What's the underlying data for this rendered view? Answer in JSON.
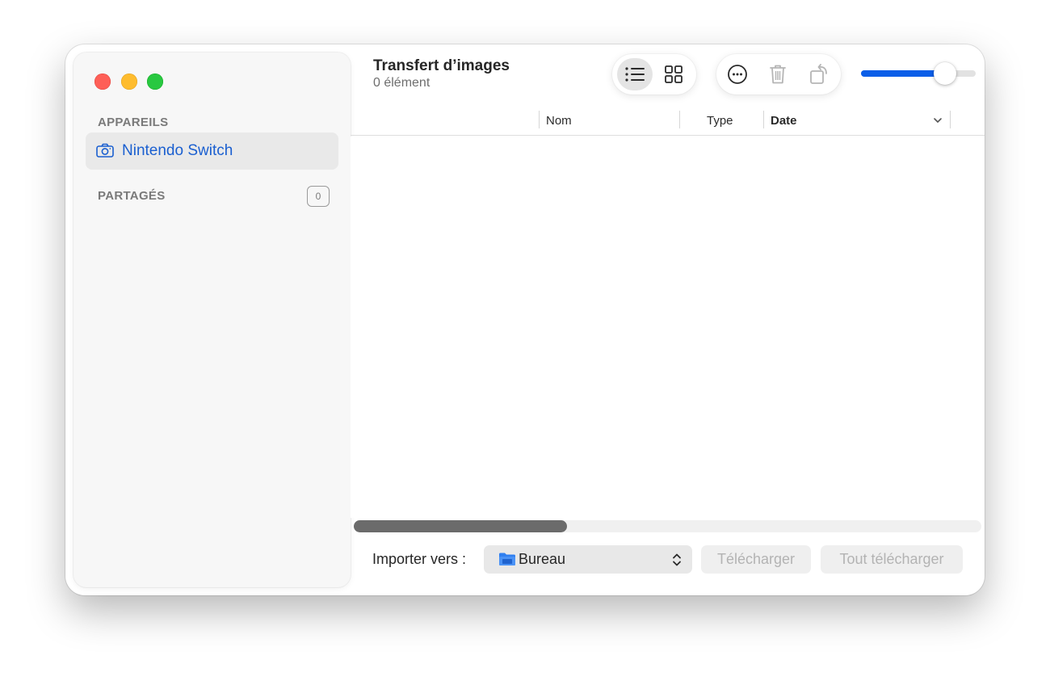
{
  "window": {
    "title": "Transfert d’images",
    "subtitle": "0 élément"
  },
  "sidebar": {
    "devices_header": "APPAREILS",
    "devices": [
      {
        "label": "Nintendo Switch",
        "icon": "camera-icon",
        "selected": true
      }
    ],
    "shared_header": "PARTAGÉS",
    "shared_count": "0"
  },
  "toolbar": {
    "view_modes": [
      {
        "name": "list-view",
        "icon": "list-icon",
        "active": true
      },
      {
        "name": "grid-view",
        "icon": "grid-icon",
        "active": false
      }
    ],
    "actions": [
      {
        "name": "more",
        "icon": "ellipsis-circle-icon",
        "enabled": true
      },
      {
        "name": "delete",
        "icon": "trash-icon",
        "enabled": false
      },
      {
        "name": "rotate",
        "icon": "rotate-icon",
        "enabled": false
      }
    ],
    "thumbnail_size": 0.73
  },
  "columns": {
    "name": "Nom",
    "type": "Type",
    "date": "Date",
    "sorted_by": "Date"
  },
  "items": [],
  "scroll": {
    "horizontal_visible_fraction": 0.34
  },
  "footer": {
    "import_label": "Importer vers :",
    "destination": "Bureau",
    "destination_icon": "folder-icon",
    "download_label": "Télécharger",
    "download_all_label": "Tout télécharger"
  },
  "colors": {
    "accent": "#0a5ee8",
    "sidebar_selected_text": "#1a5fd0",
    "traffic_close": "#fe5f57",
    "traffic_minimize": "#febc2e",
    "traffic_maximize": "#28c840",
    "folder": "#2f7ff0"
  }
}
